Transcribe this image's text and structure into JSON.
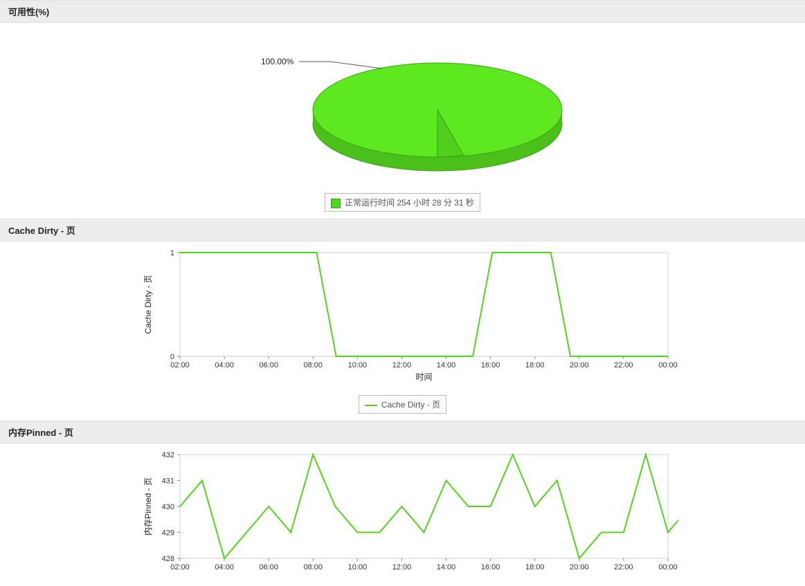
{
  "panels": {
    "availability": {
      "title": "可用性(%)",
      "pie_label": "100.00%",
      "legend": "正常运行时间 254 小时 28 分 31 秒"
    },
    "cache_dirty": {
      "title": "Cache Dirty - 页",
      "ylabel": "Cache Dirty - 页",
      "xlabel": "时间",
      "legend": "Cache Dirty - 页"
    },
    "mem_pinned": {
      "title": "内存Pinned - 页",
      "ylabel": "内存Pinned - 页"
    }
  },
  "chart_data": [
    {
      "type": "pie",
      "title": "可用性(%)",
      "slices": [
        {
          "label": "正常运行时间 254 小时 28 分 31 秒",
          "value": 100.0
        }
      ],
      "annotations": [
        "100.00%"
      ]
    },
    {
      "type": "line",
      "title": "Cache Dirty - 页",
      "xlabel": "时间",
      "ylabel": "Cache Dirty - 页",
      "ylim": [
        0,
        1
      ],
      "categories": [
        "02:00",
        "04:00",
        "06:00",
        "08:00",
        "10:00",
        "12:00",
        "14:00",
        "16:00",
        "18:00",
        "20:00",
        "22:00",
        "00:00"
      ],
      "x": [
        "02:00",
        "03:00",
        "04:00",
        "05:00",
        "06:00",
        "07:00",
        "08:00",
        "09:00",
        "09:30",
        "10:00",
        "11:00",
        "12:00",
        "13:00",
        "14:00",
        "15:00",
        "16:00",
        "16:30",
        "17:00",
        "18:00",
        "19:00",
        "19:30",
        "20:00",
        "21:00",
        "22:00",
        "23:00",
        "00:00"
      ],
      "series": [
        {
          "name": "Cache Dirty - 页",
          "values": [
            1,
            1,
            1,
            1,
            1,
            1,
            1,
            1,
            0,
            0,
            0,
            0,
            0,
            0,
            0,
            0,
            1,
            1,
            1,
            1,
            0,
            0,
            0,
            0,
            0,
            0
          ]
        }
      ]
    },
    {
      "type": "line",
      "title": "内存Pinned - 页",
      "ylabel": "内存Pinned - 页",
      "ylim": [
        428,
        432
      ],
      "categories": [
        "02:00",
        "04:00",
        "06:00",
        "08:00",
        "10:00",
        "12:00",
        "14:00",
        "16:00",
        "18:00",
        "20:00",
        "22:00",
        "00:00"
      ],
      "x": [
        "02:00",
        "03:00",
        "04:00",
        "05:00",
        "06:00",
        "07:00",
        "08:00",
        "09:00",
        "10:00",
        "11:00",
        "12:00",
        "13:00",
        "14:00",
        "15:00",
        "16:00",
        "17:00",
        "18:00",
        "19:00",
        "20:00",
        "21:00",
        "22:00",
        "23:00",
        "00:00"
      ],
      "series": [
        {
          "name": "内存Pinned - 页",
          "values": [
            430,
            431,
            428,
            429,
            430,
            429,
            432,
            430,
            429,
            429,
            430,
            429,
            431,
            430,
            430,
            432,
            430,
            431,
            428,
            429,
            429,
            432,
            429,
            430
          ]
        }
      ]
    }
  ]
}
